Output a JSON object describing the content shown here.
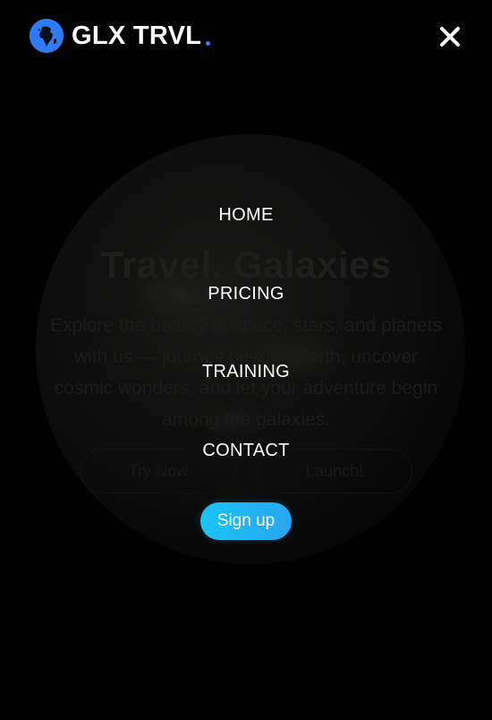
{
  "brand": {
    "name": "GLX TRVL",
    "accent_color": "#2f7bf5",
    "logo_icon": "globe-icon"
  },
  "header": {
    "close_icon": "close-icon"
  },
  "hero": {
    "title": "Travel. Galaxies",
    "description": "Explore the beauty of space, stars, and planets with us — journey beyond Earth, uncover cosmic wonders, and let your adventure begin among the galaxies.",
    "buttons": {
      "try_now": "Try Now",
      "launch": "Launch!"
    }
  },
  "menu": {
    "items": [
      {
        "label": "HOME"
      },
      {
        "label": "PRICING"
      },
      {
        "label": "TRAINING"
      },
      {
        "label": "CONTACT"
      }
    ],
    "signup_label": "Sign up",
    "signup_color": "#19c4f5"
  }
}
